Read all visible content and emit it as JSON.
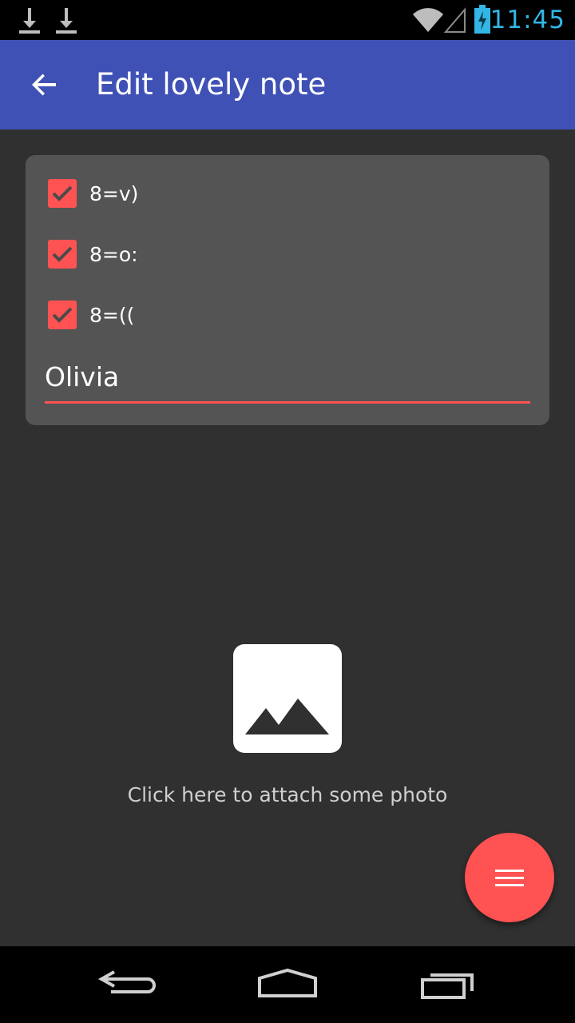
{
  "status_bar": {
    "time": "11:45",
    "icons": [
      "download-icon",
      "download-icon",
      "wifi-icon",
      "signal-icon",
      "battery-charging-icon"
    ]
  },
  "app_bar": {
    "back_icon": "arrow-left-icon",
    "title": "Edit lovely note"
  },
  "note": {
    "items": [
      {
        "label": "8=v)",
        "checked": true
      },
      {
        "label": "8=o:",
        "checked": true
      },
      {
        "label": "8=((",
        "checked": true
      }
    ],
    "title_value": "Olivia"
  },
  "attach": {
    "icon": "image-icon",
    "label": "Click here to attach some photo"
  },
  "fab": {
    "icon": "menu-icon"
  },
  "colors": {
    "status_bar": "#000000",
    "app_bar": "#3f51b5",
    "background": "#303030",
    "card": "#545454",
    "accent": "#ff5252",
    "time": "#33b5e5"
  }
}
